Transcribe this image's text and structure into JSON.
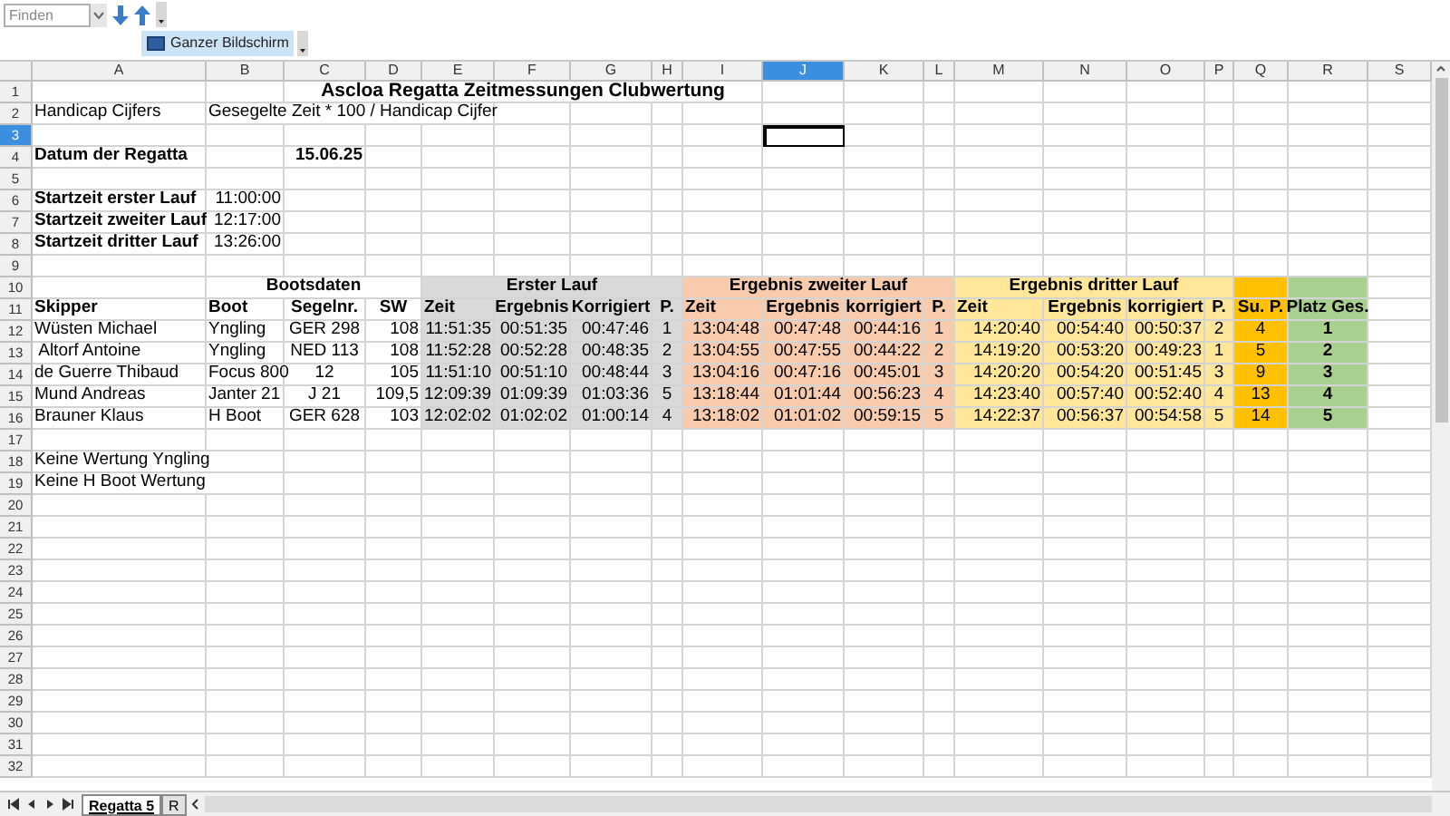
{
  "toolbar": {
    "find_placeholder": "Finden",
    "fullscreen_button": "Ganzer Bildschirm"
  },
  "columns": [
    {
      "label": "A",
      "selected": false
    },
    {
      "label": "B",
      "selected": false
    },
    {
      "label": "C",
      "selected": false
    },
    {
      "label": "D",
      "selected": false
    },
    {
      "label": "E",
      "selected": false
    },
    {
      "label": "F",
      "selected": false
    },
    {
      "label": "G",
      "selected": false
    },
    {
      "label": "H",
      "selected": false
    },
    {
      "label": "I",
      "selected": false
    },
    {
      "label": "J",
      "selected": true
    },
    {
      "label": "K",
      "selected": false
    },
    {
      "label": "L",
      "selected": false
    },
    {
      "label": "M",
      "selected": false
    },
    {
      "label": "N",
      "selected": false
    },
    {
      "label": "O",
      "selected": false
    },
    {
      "label": "P",
      "selected": false
    },
    {
      "label": "Q",
      "selected": false
    },
    {
      "label": "R",
      "selected": false
    },
    {
      "label": "S",
      "selected": false
    }
  ],
  "rows": [
    {
      "number": "1",
      "selected": false,
      "cells": [
        {
          "kind": "empty"
        },
        {
          "kind": "empty"
        },
        {
          "kind": "title",
          "text": "Ascloa Regatta Zeitmessungen Clubwertung"
        },
        {
          "kind": "merged"
        },
        {
          "kind": "merged"
        },
        {
          "kind": "merged"
        },
        {
          "kind": "merged"
        },
        {
          "kind": "merged"
        },
        {
          "kind": "merged"
        }
      ]
    },
    {
      "number": "2",
      "selected": false,
      "cells": [
        {
          "kind": "text",
          "text": "Handicap Cijfers"
        },
        {
          "kind": "text",
          "text": "Gesegelte Zeit * 100 / Handicap Cijfer"
        },
        {
          "kind": "merged"
        },
        {
          "kind": "merged"
        },
        {
          "kind": "merged"
        }
      ]
    },
    {
      "number": "3",
      "selected": true
    },
    {
      "number": "4",
      "selected": false,
      "cells": [
        {
          "kind": "bold",
          "text": "Datum der Regatta"
        },
        {
          "kind": "empty"
        },
        {
          "kind": "bold_value",
          "text": "15.06.25"
        }
      ]
    },
    {
      "number": "5",
      "selected": false
    },
    {
      "number": "6",
      "selected": false,
      "cells": [
        {
          "kind": "bold",
          "text": "Startzeit erster Lauf"
        },
        {
          "kind": "value",
          "text": "11:00:00"
        }
      ]
    },
    {
      "number": "7",
      "selected": false,
      "cells": [
        {
          "kind": "bold",
          "text": "Startzeit zweiter Lauf"
        },
        {
          "kind": "value",
          "text": "12:17:00"
        }
      ]
    },
    {
      "number": "8",
      "selected": false,
      "cells": [
        {
          "kind": "bold",
          "text": "Startzeit dritter Lauf"
        },
        {
          "kind": "value",
          "text": "13:26:00"
        }
      ]
    },
    {
      "number": "9",
      "selected": false
    },
    {
      "number": "10",
      "selected": false,
      "cells": [
        {
          "kind": "empty"
        },
        {
          "kind": "heading",
          "text": "Bootsdaten"
        },
        {
          "kind": "merged"
        },
        {
          "kind": "merged"
        },
        {
          "kind": "heading",
          "color": "#d9d9d9",
          "text": "Erster Lauf"
        },
        {
          "kind": "merged"
        },
        {
          "kind": "merged"
        },
        {
          "kind": "merged"
        },
        {
          "kind": "heading",
          "color": "#f8cbad",
          "text": "Ergebnis zweiter Lauf"
        },
        {
          "kind": "merged"
        },
        {
          "kind": "merged"
        },
        {
          "kind": "merged"
        },
        {
          "kind": "heading",
          "color": "#ffe699",
          "text": "Ergebnis dritter Lauf"
        },
        {
          "kind": "merged"
        },
        {
          "kind": "merged"
        },
        {
          "kind": "merged"
        },
        {
          "kind": "heading",
          "color": "#ffc000"
        },
        {
          "kind": "heading",
          "color": "#a9d08e"
        }
      ]
    },
    {
      "number": "11",
      "selected": false,
      "cells": [
        {
          "kind": "header",
          "text": "Skipper"
        },
        {
          "kind": "header",
          "text": "Boot"
        },
        {
          "kind": "header_center",
          "text": "Segelnr."
        },
        {
          "kind": "header_center",
          "text": "SW"
        },
        {
          "kind": "header",
          "color": "#d9d9d9",
          "text": "Zeit"
        },
        {
          "kind": "header_center",
          "color": "#d9d9d9",
          "text": "Ergebnis"
        },
        {
          "kind": "header_center",
          "color": "#d9d9d9",
          "text": "Korrigiert"
        },
        {
          "kind": "header_center",
          "color": "#d9d9d9",
          "text": "P."
        },
        {
          "kind": "header",
          "color": "#f8cbad",
          "text": "Zeit"
        },
        {
          "kind": "header_center",
          "color": "#f8cbad",
          "text": "Ergebnis"
        },
        {
          "kind": "header_center",
          "color": "#f8cbad",
          "text": "korrigiert"
        },
        {
          "kind": "header_center",
          "color": "#f8cbad",
          "text": "P."
        },
        {
          "kind": "header",
          "color": "#ffe699",
          "text": "Zeit"
        },
        {
          "kind": "header_center",
          "color": "#ffe699",
          "text": "Ergebnis"
        },
        {
          "kind": "header_center",
          "color": "#ffe699",
          "text": "korrigiert"
        },
        {
          "kind": "header_center",
          "color": "#ffe699",
          "text": "P."
        },
        {
          "kind": "header_center",
          "color": "#ffc000",
          "text": "Su. P."
        },
        {
          "kind": "header_center",
          "color": "#a9d08e",
          "text": "Platz Ges."
        }
      ]
    },
    {
      "number": "12",
      "selected": false,
      "cells": [
        {
          "kind": "text",
          "text": "Wüsten Michael"
        },
        {
          "kind": "text",
          "text": "Yngling"
        },
        {
          "kind": "center",
          "text": "GER 298"
        },
        {
          "kind": "value",
          "text": "108"
        },
        {
          "kind": "value",
          "color": "#d9d9d9",
          "text": "11:51:35"
        },
        {
          "kind": "value",
          "color": "#d9d9d9",
          "text": "00:51:35"
        },
        {
          "kind": "value",
          "color": "#d9d9d9",
          "text": "00:47:46"
        },
        {
          "kind": "center",
          "color": "#d9d9d9",
          "text": "1"
        },
        {
          "kind": "value",
          "color": "#f8cbad",
          "text": "13:04:48"
        },
        {
          "kind": "value",
          "color": "#f8cbad",
          "text": "00:47:48"
        },
        {
          "kind": "value",
          "color": "#f8cbad",
          "text": "00:44:16"
        },
        {
          "kind": "center",
          "color": "#f8cbad",
          "text": "1"
        },
        {
          "kind": "value",
          "color": "#ffe699",
          "text": "14:20:40"
        },
        {
          "kind": "value",
          "color": "#ffe699",
          "text": "00:54:40"
        },
        {
          "kind": "value",
          "color": "#ffe699",
          "text": "00:50:37"
        },
        {
          "kind": "center",
          "color": "#ffe699",
          "text": "2"
        },
        {
          "kind": "center",
          "color": "#ffc000",
          "text": "4"
        },
        {
          "kind": "center_bold",
          "color": "#a9d08e",
          "text": "1"
        }
      ]
    },
    {
      "number": "13",
      "selected": false,
      "cells": [
        {
          "kind": "text",
          "text": " Altorf Antoine"
        },
        {
          "kind": "text",
          "text": "Yngling"
        },
        {
          "kind": "center",
          "text": "NED 113"
        },
        {
          "kind": "value",
          "text": "108"
        },
        {
          "kind": "value",
          "color": "#d9d9d9",
          "text": "11:52:28"
        },
        {
          "kind": "value",
          "color": "#d9d9d9",
          "text": "00:52:28"
        },
        {
          "kind": "value",
          "color": "#d9d9d9",
          "text": "00:48:35"
        },
        {
          "kind": "center",
          "color": "#d9d9d9",
          "text": "2"
        },
        {
          "kind": "value",
          "color": "#f8cbad",
          "text": "13:04:55"
        },
        {
          "kind": "value",
          "color": "#f8cbad",
          "text": "00:47:55"
        },
        {
          "kind": "value",
          "color": "#f8cbad",
          "text": "00:44:22"
        },
        {
          "kind": "center",
          "color": "#f8cbad",
          "text": "2"
        },
        {
          "kind": "value",
          "color": "#ffe699",
          "text": "14:19:20"
        },
        {
          "kind": "value",
          "color": "#ffe699",
          "text": "00:53:20"
        },
        {
          "kind": "value",
          "color": "#ffe699",
          "text": "00:49:23"
        },
        {
          "kind": "center",
          "color": "#ffe699",
          "text": "1"
        },
        {
          "kind": "center",
          "color": "#ffc000",
          "text": "5"
        },
        {
          "kind": "center_bold",
          "color": "#a9d08e",
          "text": "2"
        }
      ]
    },
    {
      "number": "14",
      "selected": false,
      "cells": [
        {
          "kind": "text",
          "text": "de Guerre Thibaud"
        },
        {
          "kind": "text",
          "text": "Focus 800"
        },
        {
          "kind": "center",
          "text": "12"
        },
        {
          "kind": "value",
          "text": "105"
        },
        {
          "kind": "value",
          "color": "#d9d9d9",
          "text": "11:51:10"
        },
        {
          "kind": "value",
          "color": "#d9d9d9",
          "text": "00:51:10"
        },
        {
          "kind": "value",
          "color": "#d9d9d9",
          "text": "00:48:44"
        },
        {
          "kind": "center",
          "color": "#d9d9d9",
          "text": "3"
        },
        {
          "kind": "value",
          "color": "#f8cbad",
          "text": "13:04:16"
        },
        {
          "kind": "value",
          "color": "#f8cbad",
          "text": "00:47:16"
        },
        {
          "kind": "value",
          "color": "#f8cbad",
          "text": "00:45:01"
        },
        {
          "kind": "center",
          "color": "#f8cbad",
          "text": "3"
        },
        {
          "kind": "value",
          "color": "#ffe699",
          "text": "14:20:20"
        },
        {
          "kind": "value",
          "color": "#ffe699",
          "text": "00:54:20"
        },
        {
          "kind": "value",
          "color": "#ffe699",
          "text": "00:51:45"
        },
        {
          "kind": "center",
          "color": "#ffe699",
          "text": "3"
        },
        {
          "kind": "center",
          "color": "#ffc000",
          "text": "9"
        },
        {
          "kind": "center_bold",
          "color": "#a9d08e",
          "text": "3"
        }
      ]
    },
    {
      "number": "15",
      "selected": false,
      "cells": [
        {
          "kind": "text",
          "text": "Mund Andreas"
        },
        {
          "kind": "text",
          "text": "Janter 21"
        },
        {
          "kind": "center",
          "text": "J 21"
        },
        {
          "kind": "value",
          "text": "109,5"
        },
        {
          "kind": "value",
          "color": "#d9d9d9",
          "text": "12:09:39"
        },
        {
          "kind": "value",
          "color": "#d9d9d9",
          "text": "01:09:39"
        },
        {
          "kind": "value",
          "color": "#d9d9d9",
          "text": "01:03:36"
        },
        {
          "kind": "center",
          "color": "#d9d9d9",
          "text": "5"
        },
        {
          "kind": "value",
          "color": "#f8cbad",
          "text": "13:18:44"
        },
        {
          "kind": "value",
          "color": "#f8cbad",
          "text": "01:01:44"
        },
        {
          "kind": "value",
          "color": "#f8cbad",
          "text": "00:56:23"
        },
        {
          "kind": "center",
          "color": "#f8cbad",
          "text": "4"
        },
        {
          "kind": "value",
          "color": "#ffe699",
          "text": "14:23:40"
        },
        {
          "kind": "value",
          "color": "#ffe699",
          "text": "00:57:40"
        },
        {
          "kind": "value",
          "color": "#ffe699",
          "text": "00:52:40"
        },
        {
          "kind": "center",
          "color": "#ffe699",
          "text": "4"
        },
        {
          "kind": "center",
          "color": "#ffc000",
          "text": "13"
        },
        {
          "kind": "center_bold",
          "color": "#a9d08e",
          "text": "4"
        }
      ]
    },
    {
      "number": "16",
      "selected": false,
      "cells": [
        {
          "kind": "text",
          "text": "Brauner Klaus"
        },
        {
          "kind": "text",
          "text": "H Boot"
        },
        {
          "kind": "center",
          "text": "GER 628"
        },
        {
          "kind": "value",
          "text": "103"
        },
        {
          "kind": "value",
          "color": "#d9d9d9",
          "text": "12:02:02"
        },
        {
          "kind": "value",
          "color": "#d9d9d9",
          "text": "01:02:02"
        },
        {
          "kind": "value",
          "color": "#d9d9d9",
          "text": "01:00:14"
        },
        {
          "kind": "center",
          "color": "#d9d9d9",
          "text": "4"
        },
        {
          "kind": "value",
          "color": "#f8cbad",
          "text": "13:18:02"
        },
        {
          "kind": "value",
          "color": "#f8cbad",
          "text": "01:01:02"
        },
        {
          "kind": "value",
          "color": "#f8cbad",
          "text": "00:59:15"
        },
        {
          "kind": "center",
          "color": "#f8cbad",
          "text": "5"
        },
        {
          "kind": "value",
          "color": "#ffe699",
          "text": "14:22:37"
        },
        {
          "kind": "value",
          "color": "#ffe699",
          "text": "00:56:37"
        },
        {
          "kind": "value",
          "color": "#ffe699",
          "text": "00:54:58"
        },
        {
          "kind": "center",
          "color": "#ffe699",
          "text": "5"
        },
        {
          "kind": "center",
          "color": "#ffc000",
          "text": "14"
        },
        {
          "kind": "center_bold",
          "color": "#a9d08e",
          "text": "5"
        }
      ]
    },
    {
      "number": "17",
      "selected": false
    },
    {
      "number": "18",
      "selected": false,
      "cells": [
        {
          "kind": "text",
          "text": "Keine Wertung Yngling"
        },
        {
          "kind": "merged"
        }
      ]
    },
    {
      "number": "19",
      "selected": false,
      "cells": [
        {
          "kind": "text",
          "text": "Keine H Boot Wertung"
        },
        {
          "kind": "merged"
        }
      ]
    },
    {
      "number": "20",
      "selected": false
    },
    {
      "number": "21",
      "selected": false
    },
    {
      "number": "22",
      "selected": false
    },
    {
      "number": "23",
      "selected": false
    },
    {
      "number": "24",
      "selected": false
    },
    {
      "number": "25",
      "selected": false
    },
    {
      "number": "26",
      "selected": false
    },
    {
      "number": "27",
      "selected": false
    },
    {
      "number": "28",
      "selected": false
    },
    {
      "number": "29",
      "selected": false
    },
    {
      "number": "30",
      "selected": false
    },
    {
      "number": "31",
      "selected": false
    },
    {
      "number": "32",
      "selected": false
    }
  ],
  "sheet_tabs": [
    {
      "label": "Regatta 5",
      "selected": true
    },
    {
      "label": "R",
      "selected": false
    }
  ]
}
